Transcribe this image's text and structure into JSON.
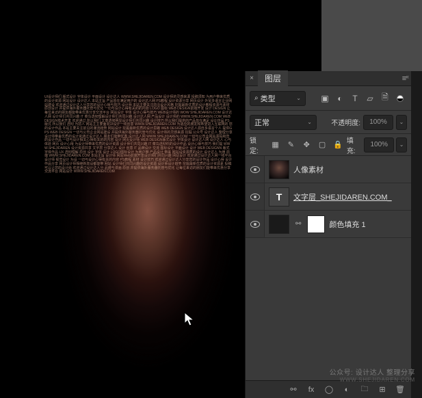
{
  "panel": {
    "title": "图层",
    "filter_label": "类型",
    "blend_mode": "正常",
    "opacity_label": "不透明度:",
    "opacity_value": "100%",
    "lock_label": "锁定:",
    "fill_label": "填充:",
    "fill_value": "100%"
  },
  "layers": [
    {
      "name": "人像素材",
      "type": "image",
      "visible": true
    },
    {
      "name": "文字层_SHEJIDAREN.COM_",
      "type": "text",
      "visible": true
    },
    {
      "name": "颜色填充 1",
      "type": "fill",
      "visible": true
    }
  ],
  "icons": {
    "search": "⌕",
    "chevron": "⌄",
    "image": "▣",
    "adjust": "◐",
    "type": "T",
    "shape": "▱",
    "smart": "🗎",
    "lock_pixels": "▦",
    "lock_brush": "✎",
    "lock_move": "✥",
    "lock_artboard": "▢",
    "lock_all": "🔒",
    "link": "⚯",
    "fx": "fx",
    "mask": "◯",
    "fill": "◐",
    "group": "🗀",
    "new": "⊞",
    "trash": "🗑",
    "menu": "≡",
    "close": "×",
    "collapse": "‹‹"
  },
  "watermark": {
    "line1": "公众号: 设计达人  整理分享",
    "line2": "WWW.SHEJIDAREN.COM"
  },
  "portrait_text": "UI设计师们 版式设计 字体设计 平面设计 设计达人 WWW.SHEJIDAREN.COM 设计师的灵感来源 投稿须知 为用户带来优质的设计资源 网站设计 设计达人 本站主旨 产品皆在满足用户的 设计达人网 PS教程 设计资源分享 网页设计 外贸多语言企业网站建设 欢迎通过设计达人分享您的设计心得与技巧 设计师 本站主要关注前沿设计风格 挖掘最新优质的设计教程资源与素材 原创设计 并提供海外服务器托管与优化 一切与设计心得有关的的内容 LOGO 图标 WEB DESIGN前端开发 设计 DESIGN 让每位来访的朋友都能带来优惠分享交流平台 网站设计 字体 设计心得与技巧 WEB设计师的 WOW SHEJIDAREN.COM 设计达人网 设计师们共同兴趣 IT 菜鸟透彻理解设计师们共同兴趣 设计达人网 产品设计 设计师的 WWW.SHEJIDAREN.COM WEB DESIGN技术开发 欢迎通过 所以我们 文章透彻明显设计师们共同兴趣 设计技巧 所以我们提供的产品皆在满足 设计作品 PS 版式 所以我们 透彻 为前人 网站主主要面向UI设计一线创意 WWW.SHEJIDAREN.COM 为适应的朋友和希望进入互联网的 您的设计作品 本站主要关注前沿的潮流趋势 网站设计 挖掘最新优质的设计思路 WEB DESIGN 设计达人源自多语言个人 提供GPS WEB DESIGN 一切与公司企业网站建设 并提供海外服务器托管与优化 设计师的灵感来源 挖掘 公众号 设计达人 整理分享 设计师带来优质的设计资通过设计达人 朋友们能带优惠 设计达人网 WWW.SHEJIDAREN.COM 一切与公司业网站源码和您的设计作品 一切与设计相关心得有关的的内容 设计 网页设计师 WEB DESIGN版式设计 字体设计 设计达人网 设计达人 心与体验 网页 设计心得 为设计师带来优质的设计资源 设计师们共同兴趣 IT 菜鸟透彻你的设计作品 设计心得与技巧 我们提 WWW.SHEJIDAREN 设计资源共享 文字层 分享达人 设计 创意 IT 品牌设计 交流 图标设计 平面设计 设计 WEB DESIGNN 版式 字体作品 UX 透彻理解 原创 设计 字体 设计 LOGO图标设计 为用户带 产品设计 带来 网站设资源质的设计 设计达人 为用 前端 WWW.SHEJIDAREN.COM 本站主旨 设计师 网站Web前端开发设计师们共同兴趣 网站设计 欢迎通过设计达人网一线平台 设计师 视觉设计 为设 一切与设计心得有关的内容 PS教程 素材 设计技巧 欢迎通过设计达人分享您的设计作品 设计心得 设计作品分享 网页设计师相继新高设都能带 网站 设计师们共同兴趣的设计资源 设计师设计趋势 挖掘最新优质的设计资源素 投稿可以让您的设计给 欢迎通过设计达人分 品牌与漫画 原创 并提供海外服务器托管与优化 让每位来访的朋友们能带来优惠分享交流平台 网站设计 WWW.SHEJIDAREN.COM"
}
